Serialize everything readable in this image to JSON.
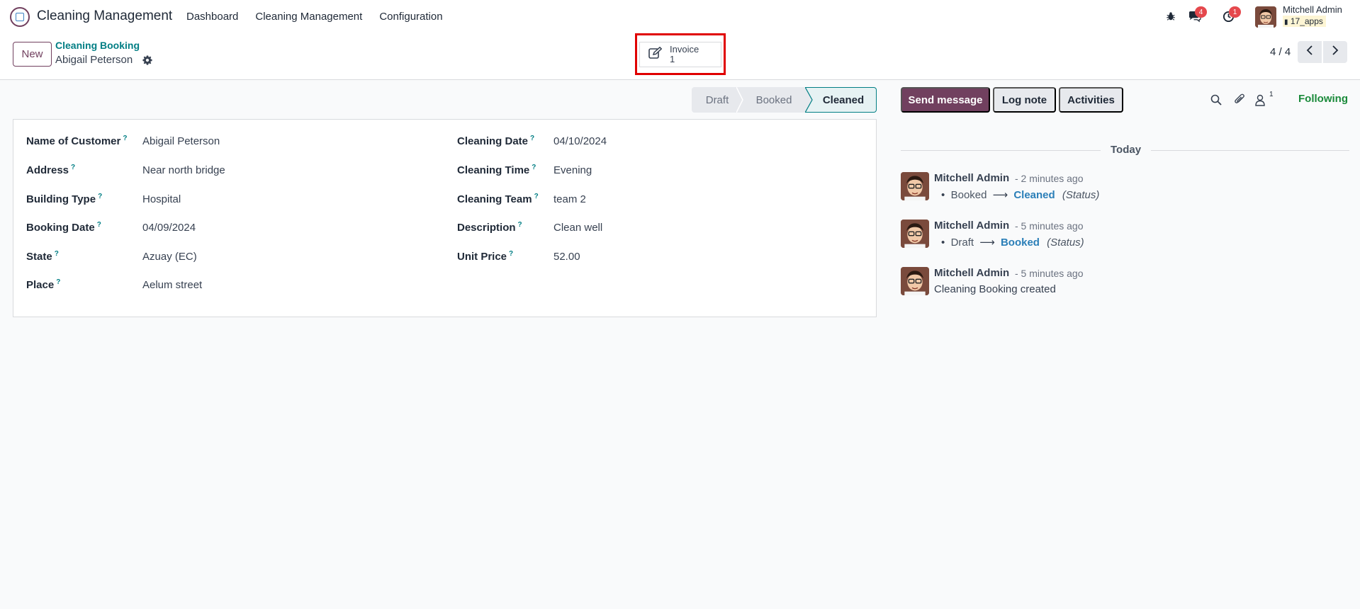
{
  "navbar": {
    "app_title": "Cleaning Management",
    "menu": [
      "Dashboard",
      "Cleaning Management",
      "Configuration"
    ],
    "tray": {
      "messages_badge": "4",
      "activities_badge": "1",
      "user_name": "Mitchell Admin",
      "database": "17_apps"
    }
  },
  "control": {
    "new_label": "New",
    "breadcrumb_parent": "Cleaning Booking",
    "breadcrumb_current": "Abigail Peterson",
    "smart_button_label": "Invoice",
    "smart_button_count": "1",
    "pager": "4 / 4"
  },
  "status_bar": {
    "stages": [
      "Draft",
      "Booked",
      "Cleaned"
    ],
    "current": "Cleaned"
  },
  "form": {
    "left": [
      {
        "label": "Name of Customer",
        "value": "Abigail Peterson"
      },
      {
        "label": "Address",
        "value": "Near north bridge"
      },
      {
        "label": "Building Type",
        "value": "Hospital"
      },
      {
        "label": "Booking Date",
        "value": "04/09/2024"
      },
      {
        "label": "State",
        "value": "Azuay (EC)"
      },
      {
        "label": "Place",
        "value": "Aelum street"
      }
    ],
    "right": [
      {
        "label": "Cleaning Date",
        "value": "04/10/2024"
      },
      {
        "label": "Cleaning Time",
        "value": "Evening"
      },
      {
        "label": "Cleaning Team",
        "value": "team 2"
      },
      {
        "label": "Description",
        "value": "Clean well"
      },
      {
        "label": "Unit Price",
        "value": "52.00"
      }
    ],
    "help_mark": "?"
  },
  "chatter": {
    "send_message": "Send message",
    "log_note": "Log note",
    "activities": "Activities",
    "follower_count": "1",
    "following": "Following",
    "today": "Today",
    "messages": [
      {
        "author": "Mitchell Admin",
        "time": "- 2 minutes ago",
        "old": "Booked",
        "new": "Cleaned",
        "field": "(Status)"
      },
      {
        "author": "Mitchell Admin",
        "time": "- 5 minutes ago",
        "old": "Draft",
        "new": "Booked",
        "field": "(Status)"
      },
      {
        "author": "Mitchell Admin",
        "time": "- 5 minutes ago",
        "body": "Cleaning Booking created"
      }
    ]
  },
  "colors": {
    "brand": "#71405f",
    "accent_teal": "#017e84",
    "highlight": "#e00000",
    "following_green": "#1a8a3a"
  }
}
